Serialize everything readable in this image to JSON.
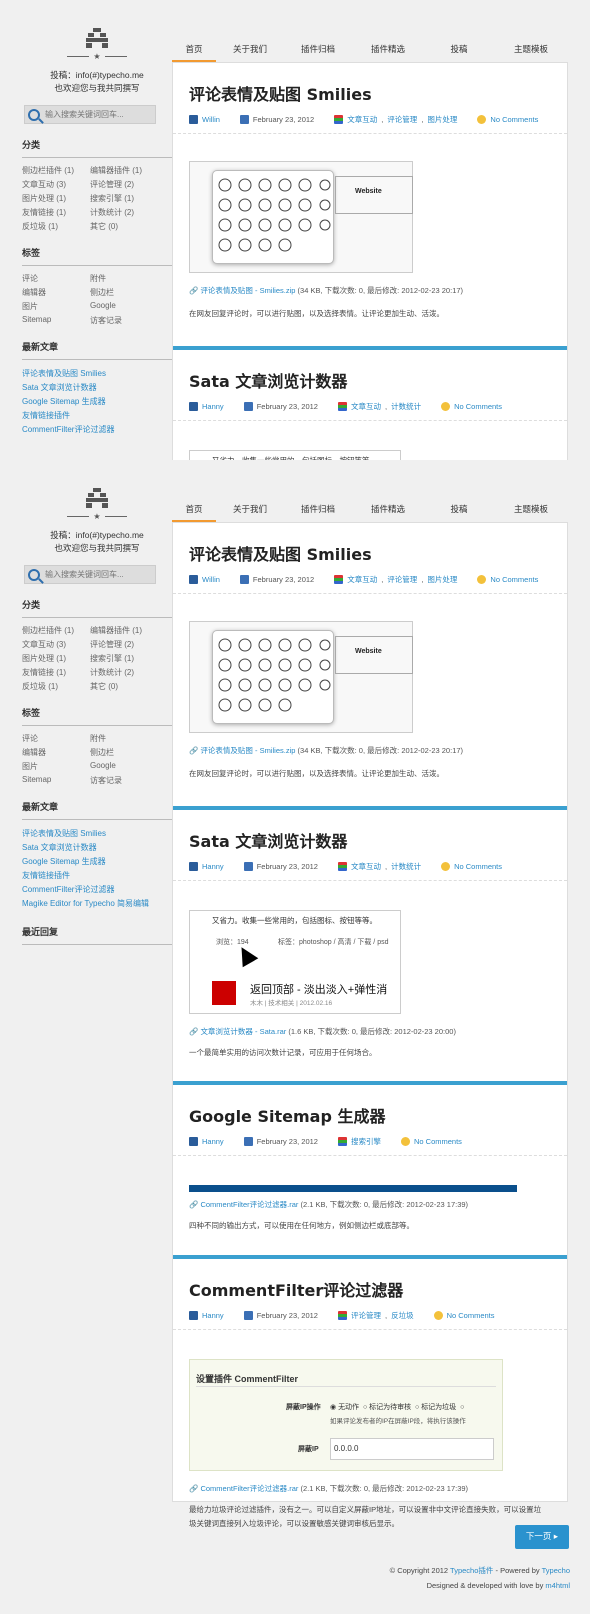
{
  "brand": {
    "tagline_line": "★",
    "contrib": "投稿：info(#)typecho.me",
    "invite": "也欢迎您与我共同撰写"
  },
  "search": {
    "placeholder": "输入搜索关键词回车..."
  },
  "sidebar": {
    "categories_title": "分类",
    "categories": [
      [
        "侧边栏插件 (1)",
        "编辑器插件 (1)"
      ],
      [
        "文章互动 (3)",
        "评论管理 (2)"
      ],
      [
        "图片处理 (1)",
        "搜索引擎 (1)"
      ],
      [
        "友情链接 (1)",
        "计数统计 (2)"
      ],
      [
        "反垃圾 (1)",
        "其它 (0)"
      ]
    ],
    "tags_title": "标签",
    "tags": [
      [
        "评论",
        "附件"
      ],
      [
        "编辑器",
        "侧边栏"
      ],
      [
        "图片",
        "Google"
      ],
      [
        "Sitemap",
        "访客记录"
      ]
    ],
    "recent_title": "最新文章",
    "recent_top": [
      "评论表情及贴图 Smilies",
      "Sata 文章浏览计数器",
      "Google Sitemap 生成器",
      "友情链接插件",
      "CommentFilter评论过滤器"
    ],
    "recent_bottom": [
      "评论表情及贴图 Smilies",
      "Sata 文章浏览计数器",
      "Google Sitemap 生成器",
      "友情链接插件",
      "CommentFilter评论过滤器",
      "Magike Editor for Typecho 简易编辑"
    ],
    "replies_title": "最近回复"
  },
  "nav": [
    "首页",
    "关于我们",
    "插件归档",
    "插件精选",
    "投稿",
    "主题模板"
  ],
  "posts": [
    {
      "title": "评论表情及贴图 Smilies",
      "author": "Willin",
      "date": "February 23, 2012",
      "cats": [
        "文章互动",
        "评论管理",
        "图片处理"
      ],
      "comments": "No Comments",
      "attach_link": "评论表情及贴图 - Smilies.zip",
      "attach_info": "(34 KB, 下载次数: 0, 最后修改: 2012-02-23 20:17)",
      "desc": "在网友回复评论时，可以进行贴图，以及选择表情。让评论更加生动、活泼。",
      "thumb_label": "Website"
    },
    {
      "title": "Sata 文章浏览计数器",
      "author": "Hanny",
      "date": "February 23, 2012",
      "cats": [
        "文章互动",
        "计数统计"
      ],
      "comments": "No Comments",
      "shot_line": "又省力。收集一些常用的，包括图标、按钮等等。",
      "views_label": "浏览：194",
      "tags_label": "标签：",
      "shot_tags": "photoshop / 高清 / 下载 / psd",
      "related_title": "返回顶部 - 淡出淡入+弹性消",
      "related_meta": "木木 | 技术相关 | 2012.02.16",
      "attach_link": "文章浏览计数器 - Sata.rar",
      "attach_info": "(1.6 KB, 下载次数: 0, 最后修改: 2012-02-23 20:00)",
      "desc": "一个最简单实用的访问次数计记录，可应用于任何场合。"
    },
    {
      "title": "Google Sitemap 生成器",
      "author": "Hanny",
      "date": "February 23, 2012",
      "cats": [
        "搜索引擎"
      ],
      "comments": "No Comments",
      "attach_link": "CommentFilter评论过滤器.rar",
      "attach_info": "(2.1 KB, 下载次数: 0, 最后修改: 2012-02-23 17:39)",
      "desc": "四种不同的输出方式，可以使用在任何地方，例如侧边栏或底部等。"
    },
    {
      "title": "CommentFilter评论过滤器",
      "author": "Hanny",
      "date": "February 23, 2012",
      "cats": [
        "评论管理",
        "反垃圾"
      ],
      "comments": "No Comments",
      "plugin_title": "设置插件 CommentFilter",
      "ip_label": "屏蔽IP操作",
      "opt1": "无动作",
      "opt2": "标记为待审核",
      "opt3": "标记为垃圾",
      "ip_note": "如果评论发布者的IP在屏蔽IP段，将执行该操作",
      "ip_field_label": "屏蔽IP",
      "ip_value": "0.0.0.0",
      "attach_link": "CommentFilter评论过滤器.rar",
      "attach_info": "(2.1 KB, 下载次数: 0, 最后修改: 2012-02-23 17:39)",
      "desc": "最给力垃圾评论过滤插件，没有之一。可以自定义屏蔽IP地址，可以设置非中文评论直接失败，可以设置垃圾关键词直接列入垃圾评论，可以设置敏感关键词审核后显示。"
    }
  ],
  "pager": {
    "next": "下一页 ▸"
  },
  "footer": {
    "line1_pre": "© Copyright 2012 ",
    "line1_link1": "Typecho插件",
    "line1_mid": " - Powered by ",
    "line1_link2": "Typecho",
    "line2_pre": "Designed & developed with love by ",
    "line2_link": "m4html"
  },
  "colors": {
    "accent": "#3aa0d0",
    "nav_active": "#f29a31",
    "link": "#2a8ac6"
  }
}
